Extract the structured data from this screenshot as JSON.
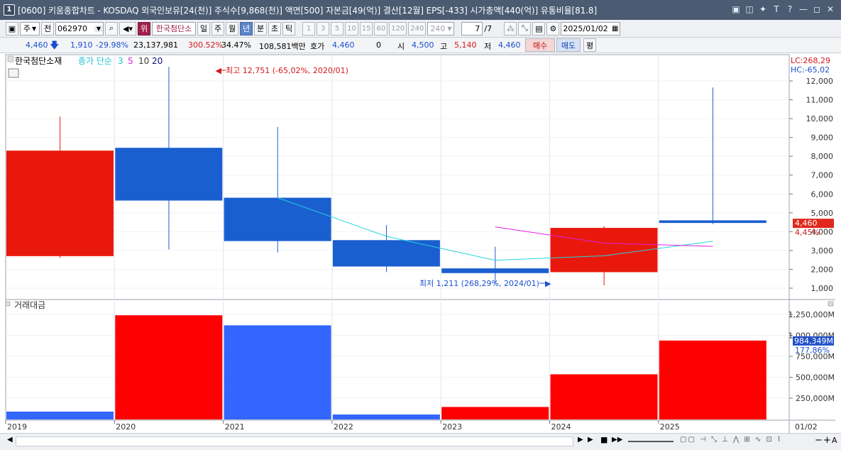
{
  "window": {
    "badge": "1",
    "title": "[0600] 키움종합차트 - KOSDAQ 외국인보유[24(천)] 주식수[9,868(천)] 액면[500] 자본금[49(억)] 결산[12월] EPS[-433] 시가총액[440(억)] 유통비율[81.8]",
    "buttons": [
      "▣",
      "◫",
      "✦",
      "T",
      "?",
      "—",
      "◻",
      "✕"
    ]
  },
  "toolbar": {
    "market": "주",
    "scope": "전",
    "code": "062970",
    "rank_badge": "위",
    "stock_name": "한국첨단소",
    "periods": [
      "일",
      "주",
      "월",
      "년",
      "분",
      "초",
      "틱"
    ],
    "selected_period": "년",
    "intervals": [
      "1",
      "3",
      "5",
      "10",
      "15",
      "60",
      "120",
      "240"
    ],
    "interval_select": "240",
    "count": "7",
    "count_total": "/7",
    "date": "2025/01/02"
  },
  "quote": {
    "price": "4,460",
    "change": "1,910",
    "change_rate": "-29.98%",
    "volume": "23,137,981",
    "vol_ratio": "300.52%",
    "turnover": "34.47%",
    "amount": "108,581백만",
    "hoga_label": "호가",
    "hoga_value": "4,460",
    "hoga_qty": "0",
    "open_label": "시",
    "open": "4,500",
    "high_label": "고",
    "high": "5,140",
    "low_label": "저",
    "low": "4,460",
    "buy_button": "매수",
    "sell_button": "매도",
    "avg_button": "평"
  },
  "chart_data": [
    {
      "type": "candlestick",
      "title": "한국첨단소재",
      "legend_prefix": "종가 단순",
      "ma_periods": [
        "3",
        "5",
        "10",
        "20"
      ],
      "ma_colors": [
        "#22d4dc",
        "#e020e0",
        "#404040",
        "#101080"
      ],
      "x": [
        "2019",
        "2020",
        "2021",
        "2022",
        "2023",
        "2024",
        "2025"
      ],
      "open": [
        2700,
        8450,
        5800,
        3550,
        2050,
        1850,
        4600
      ],
      "high": [
        10100,
        12751,
        9550,
        4350,
        3200,
        4300,
        11650
      ],
      "low": [
        2600,
        3050,
        2900,
        1850,
        1211,
        1150,
        4400
      ],
      "close": [
        8300,
        5650,
        3500,
        2150,
        1800,
        4200,
        4460
      ],
      "ma3": [
        null,
        null,
        5800,
        3750,
        2480,
        2720,
        3490
      ],
      "ma5": [
        null,
        null,
        null,
        null,
        4250,
        3390,
        3220
      ],
      "up_color": "#e8190c",
      "down_color": "#1a5fd0",
      "y_ticks": [
        "1,000",
        "2,000",
        "3,000",
        "4,000",
        "5,000",
        "6,000",
        "7,000",
        "8,000",
        "9,000",
        "10,000",
        "11,000",
        "12,000"
      ],
      "ylim": [
        500,
        13000
      ],
      "annotations": {
        "high": "최고 12,751 (-65,02%, 2020/01)",
        "low": "최저 1,211 (268,29%, 2024/01)",
        "lc": "LC:268,29",
        "hc": "HC:-65,02",
        "last_price": "4,460",
        "last_pct": "4,45%"
      }
    },
    {
      "type": "bar",
      "title": "거래대금",
      "x": [
        "2019",
        "2020",
        "2021",
        "2022",
        "2023",
        "2024",
        "2025"
      ],
      "values": [
        90,
        1240,
        1120,
        55,
        145,
        535,
        938
      ],
      "unit": "백만",
      "colors": [
        "#3366ff",
        "#ff0000",
        "#3366ff",
        "#3366ff",
        "#ff0000",
        "#ff0000",
        "#ff0000"
      ],
      "y_ticks": [
        "250,000M",
        "500,000M",
        "750,000M",
        "1,000,000M",
        "1,250,000M"
      ],
      "annotations": {
        "last_value": "984,349M",
        "last_pct": "177,86%"
      }
    }
  ],
  "x_axis": {
    "labels": [
      "2019",
      "2020",
      "2021",
      "2022",
      "2023",
      "2024",
      "2025"
    ],
    "right_label": "01/02"
  }
}
